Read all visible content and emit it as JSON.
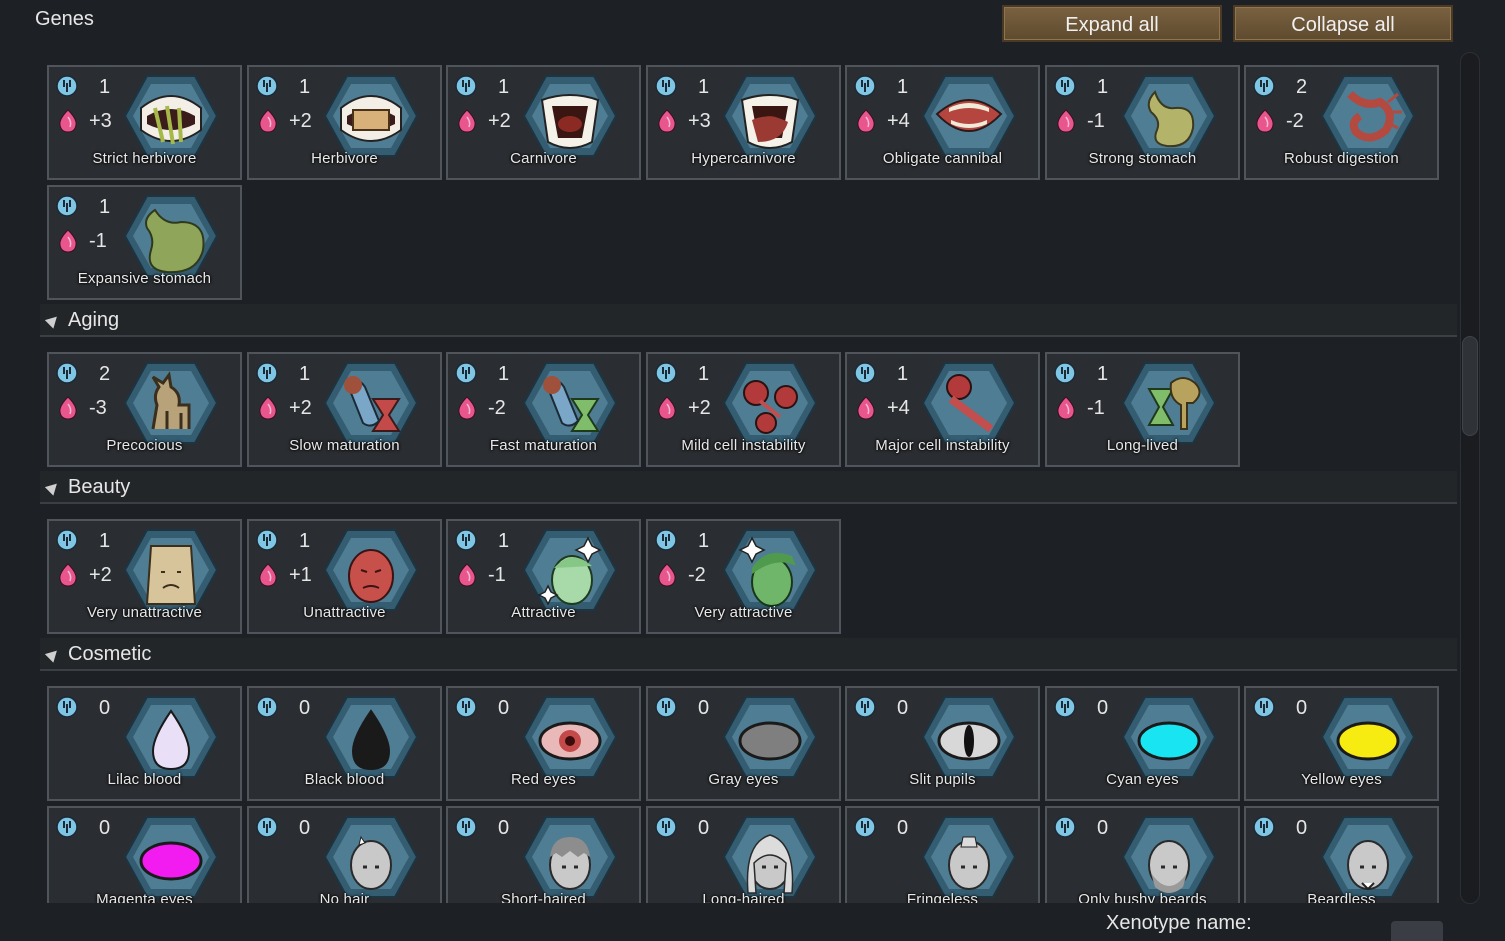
{
  "window": {
    "title": "Genes"
  },
  "header": {
    "expand_label": "Expand all",
    "collapse_label": "Collapse all"
  },
  "colors": {
    "hex_fill": "#4f7d94",
    "hex_rim": "#355d72",
    "complexity_icon": "#7fc6e4",
    "metabolism_icon": "#e9568d",
    "button_brown": "#6b5436"
  },
  "top_row1": [
    {
      "label": "Strict herbivore",
      "complexity": "1",
      "metabolism": "+3",
      "icon": "teeth-grass-icon"
    },
    {
      "label": "Herbivore",
      "complexity": "1",
      "metabolism": "+2",
      "icon": "teeth-bread-icon"
    },
    {
      "label": "Carnivore",
      "complexity": "1",
      "metabolism": "+2",
      "icon": "fangs-meat-icon"
    },
    {
      "label": "Hypercarnivore",
      "complexity": "1",
      "metabolism": "+3",
      "icon": "fangs-steak-icon"
    },
    {
      "label": "Obligate cannibal",
      "complexity": "1",
      "metabolism": "+4",
      "icon": "open-mouth-icon"
    },
    {
      "label": "Strong stomach",
      "complexity": "1",
      "metabolism": "-1",
      "icon": "stomach-icon"
    },
    {
      "label": "Robust digestion",
      "complexity": "2",
      "metabolism": "-2",
      "icon": "digestive-tract-icon"
    }
  ],
  "top_row2": [
    {
      "label": "Expansive stomach",
      "complexity": "1",
      "metabolism": "-1",
      "icon": "large-stomach-icon"
    }
  ],
  "categories": {
    "aging": {
      "label": "Aging",
      "genes": [
        {
          "label": "Precocious",
          "complexity": "2",
          "metabolism": "-3",
          "icon": "fawn-icon"
        },
        {
          "label": "Slow maturation",
          "complexity": "1",
          "metabolism": "+2",
          "icon": "hourglass-arm-red-icon"
        },
        {
          "label": "Fast maturation",
          "complexity": "1",
          "metabolism": "-2",
          "icon": "hourglass-arm-green-icon"
        },
        {
          "label": "Mild cell instability",
          "complexity": "1",
          "metabolism": "+2",
          "icon": "cells-icon"
        },
        {
          "label": "Major cell instability",
          "complexity": "1",
          "metabolism": "+4",
          "icon": "cells-broken-icon"
        },
        {
          "label": "Long-lived",
          "complexity": "1",
          "metabolism": "-1",
          "icon": "hourglass-tree-icon"
        }
      ]
    },
    "beauty": {
      "label": "Beauty",
      "genes": [
        {
          "label": "Very unattractive",
          "complexity": "1",
          "metabolism": "+2",
          "icon": "paper-bag-icon"
        },
        {
          "label": "Unattractive",
          "complexity": "1",
          "metabolism": "+1",
          "icon": "red-face-icon"
        },
        {
          "label": "Attractive",
          "complexity": "1",
          "metabolism": "-1",
          "icon": "sparkle-face-icon"
        },
        {
          "label": "Very attractive",
          "complexity": "1",
          "metabolism": "-2",
          "icon": "sparkle-face-green-icon"
        }
      ]
    },
    "cosmetic": {
      "label": "Cosmetic",
      "genes": [
        {
          "label": "Lilac blood",
          "complexity": "0",
          "icon": "lilac-drop-icon"
        },
        {
          "label": "Black blood",
          "complexity": "0",
          "icon": "black-drop-icon"
        },
        {
          "label": "Red eyes",
          "complexity": "0",
          "icon": "red-eye-icon"
        },
        {
          "label": "Gray eyes",
          "complexity": "0",
          "icon": "gray-eye-icon"
        },
        {
          "label": "Slit pupils",
          "complexity": "0",
          "icon": "slit-eye-icon"
        },
        {
          "label": "Cyan eyes",
          "complexity": "0",
          "icon": "cyan-eye-icon"
        },
        {
          "label": "Yellow eyes",
          "complexity": "0",
          "icon": "yellow-eye-icon"
        },
        {
          "label": "Magenta eyes",
          "complexity": "0",
          "icon": "magenta-eye-icon"
        },
        {
          "label": "No hair",
          "complexity": "0",
          "icon": "bald-head-icon"
        },
        {
          "label": "Short-haired",
          "complexity": "0",
          "icon": "short-hair-head-icon"
        },
        {
          "label": "Long-haired",
          "complexity": "0",
          "icon": "long-hair-head-icon"
        },
        {
          "label": "Fringeless",
          "complexity": "0",
          "icon": "fringeless-head-icon"
        },
        {
          "label": "Only bushy beards",
          "complexity": "0",
          "icon": "bushy-beard-head-icon"
        },
        {
          "label": "Beardless",
          "complexity": "0",
          "icon": "beardless-head-icon"
        }
      ]
    }
  },
  "footer": {
    "xenotype_label": "Xenotype name:"
  }
}
